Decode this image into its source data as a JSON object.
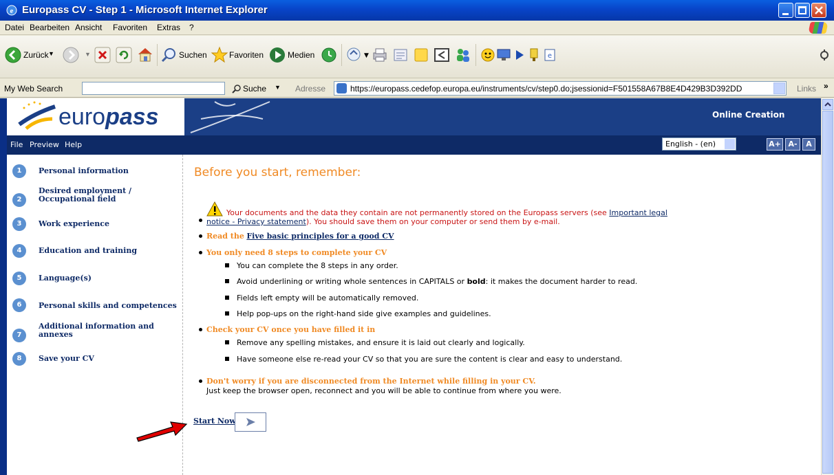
{
  "window": {
    "title": "Europass CV - Step 1 - Microsoft Internet Explorer"
  },
  "menu": [
    "Datei",
    "Bearbeiten",
    "Ansicht",
    "Favoriten",
    "Extras",
    "?"
  ],
  "toolbar": {
    "back": "Zurück",
    "search": "Suchen",
    "favorites": "Favoriten",
    "media": "Medien"
  },
  "addressbar": {
    "my_web_search": "My Web Search",
    "suche": "Suche",
    "adresse": "Adresse",
    "url": "https://europass.cedefop.europa.eu/instruments/cv/step0.do;jsessionid=F501558A67B8E4D429B3D392DD",
    "links": "Links"
  },
  "europass": {
    "logo_prefix": "euro",
    "logo_suffix": "pass",
    "online_creation": "Online Creation",
    "nav": [
      "File",
      "Preview",
      "Help"
    ],
    "language": "English - (en)",
    "font_buttons": [
      "A+",
      "A-",
      "A"
    ]
  },
  "steps": [
    {
      "num": "1",
      "lines": [
        "Personal information"
      ]
    },
    {
      "num": "2",
      "lines": [
        "Desired employment /",
        "Occupational field"
      ]
    },
    {
      "num": "3",
      "lines": [
        "Work experience"
      ]
    },
    {
      "num": "4",
      "lines": [
        "Education and training"
      ]
    },
    {
      "num": "5",
      "lines": [
        "Language(s)"
      ]
    },
    {
      "num": "6",
      "lines": [
        "Personal skills and competences"
      ]
    },
    {
      "num": "7",
      "lines": [
        "Additional information and",
        "annexes"
      ]
    },
    {
      "num": "8",
      "lines": [
        "Save your CV"
      ]
    }
  ],
  "main": {
    "title": "Before you start, remember:",
    "warning_1": "Your documents and the data they contain are not permanently stored on the Europass servers (see",
    "warning_link_1": "Important legal",
    "warning_link_2": "notice - Privacy statement",
    "warning_2": "). You should save them on your computer or send them by e-mail.",
    "read_the": "Read the",
    "five_principles": "Five basic principles for a good CV",
    "eight_steps": "You only need 8 steps to complete your CV",
    "sub1": [
      "You can complete the 8 steps in any order."
    ],
    "sub2_a": "Avoid underlining or writing whole sentences in CAPITALS or",
    "sub2_bold": "bold",
    "sub2_b": ": it makes the document harder to read.",
    "sub3": "Fields left empty will be automatically removed.",
    "sub4": "Help pop-ups on the right-hand side give examples and guidelines.",
    "check_cv": "Check your CV once you have filled it in",
    "sub5": "Remove any spelling mistakes, and ensure it is laid out clearly and logically.",
    "sub6": "Have someone else re-read your CV so that you are sure the content is clear and easy to understand.",
    "dont_worry": "Don't worry if you are disconnected from the Internet while filling in your CV.",
    "dont_worry_2": "Just keep the browser open, reconnect and you will be able to continue from where you were.",
    "start_now": "Start Now"
  },
  "colors": {
    "titlebar": "#0844c8",
    "europass_blue": "#1b3f86",
    "orange": "#f08a24",
    "warning_red": "#c81414"
  }
}
